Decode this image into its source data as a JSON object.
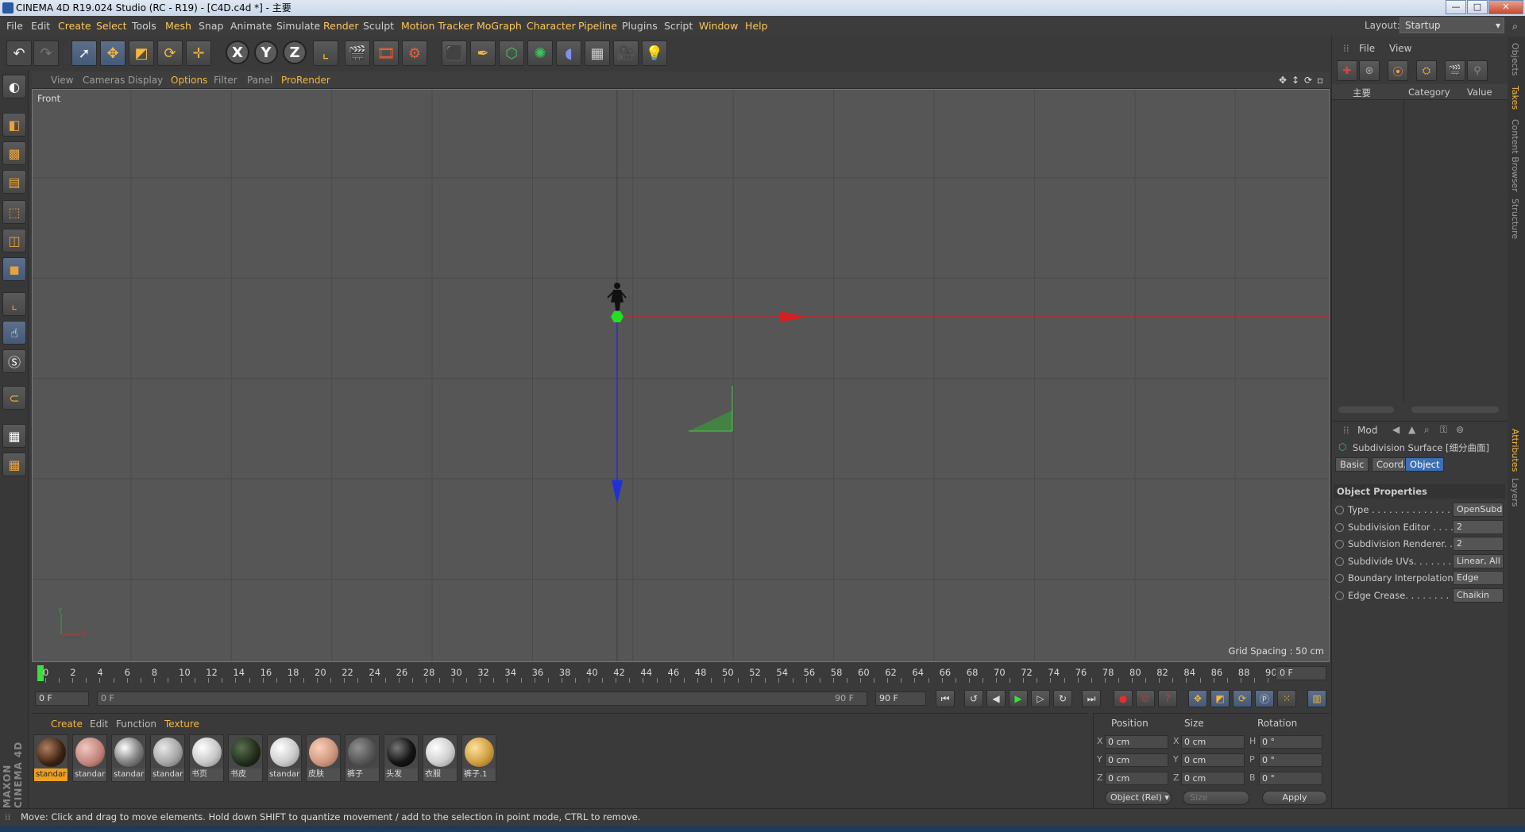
{
  "window": {
    "title": "CINEMA 4D R19.024 Studio (RC - R19) - [C4D.c4d *] - 主要",
    "minimize": "—",
    "maximize": "□",
    "close": "✕"
  },
  "menu": {
    "items": [
      "File",
      "Edit",
      "Create",
      "Select",
      "Tools",
      "Mesh",
      "Snap",
      "Animate",
      "Simulate",
      "Render",
      "Sculpt",
      "Motion Tracker",
      "MoGraph",
      "Character",
      "Pipeline",
      "Plugins",
      "Script",
      "Window",
      "Help"
    ],
    "layout_label": "Layout:",
    "layout_value": "Startup"
  },
  "toolbar": {
    "axis_x": "X",
    "axis_y": "Y",
    "axis_z": "Z"
  },
  "viewport": {
    "menu": [
      "View",
      "Cameras",
      "Display",
      "Options",
      "Filter",
      "Panel",
      "ProRender"
    ],
    "view_name": "Front",
    "grid_spacing": "Grid Spacing : 50 cm",
    "axis_y_label": "Y",
    "axis_x_label": "X",
    "colors": {
      "x_axis": "#d42020",
      "y_axis": "#22b022",
      "z_axis": "#2030d8",
      "origin": "#22e022"
    }
  },
  "timeline": {
    "ticks": [
      "0",
      "2",
      "4",
      "6",
      "8",
      "10",
      "12",
      "14",
      "16",
      "18",
      "20",
      "22",
      "24",
      "26",
      "28",
      "30",
      "32",
      "34",
      "36",
      "38",
      "40",
      "42",
      "44",
      "46",
      "48",
      "50",
      "52",
      "54",
      "56",
      "58",
      "60",
      "62",
      "64",
      "66",
      "68",
      "70",
      "72",
      "74",
      "76",
      "78",
      "80",
      "82",
      "84",
      "86",
      "88",
      "90"
    ],
    "current_frame": "0 F",
    "start_field": "0 F",
    "range_start": "0 F",
    "range_end": "90 F",
    "end_field": "90 F"
  },
  "materials": {
    "tabs": [
      "Create",
      "Edit",
      "Function",
      "Texture"
    ],
    "items": [
      {
        "label": "standar",
        "color": "radial-gradient(circle at 35% 35%, #b08060, #3a2010 60%, #111)"
      },
      {
        "label": "standar",
        "color": "radial-gradient(circle at 35% 35%, #f0c8c0, #c08078 60%, #6a3a34)"
      },
      {
        "label": "standar",
        "color": "radial-gradient(circle at 35% 35%, #ffffff, #888 50%, #333)"
      },
      {
        "label": "standar",
        "color": "radial-gradient(circle at 35% 35%, #e8e8e8, #a8a8a8 55%, #5a5a5a)"
      },
      {
        "label": "书页",
        "color": "radial-gradient(circle at 35% 35%, #ffffff, #c8c8c8 55%, #777)"
      },
      {
        "label": "书皮",
        "color": "radial-gradient(circle at 35% 35%, #5a7050, #202a1a 60%, #0a0a0a)"
      },
      {
        "label": "standar",
        "color": "radial-gradient(circle at 35% 35%, #ffffff, #cccccc 55%, #808080)"
      },
      {
        "label": "皮肤",
        "color": "radial-gradient(circle at 35% 35%, #f8d0b8, #d09880 55%, #8a5a48)"
      },
      {
        "label": "裤子",
        "color": "radial-gradient(circle at 35% 35%, #909090, #555 55%, #2a2a2a)"
      },
      {
        "label": "头发",
        "color": "radial-gradient(circle at 35% 35%, #777, #151515 55%, #000)"
      },
      {
        "label": "衣服",
        "color": "radial-gradient(circle at 35% 35%, #ffffff, #cfcfcf 55%, #808080)"
      },
      {
        "label": "裤子.1",
        "color": "radial-gradient(circle at 35% 35%, #ffe0a0, #d0a040 55%, #7a5a20)"
      }
    ]
  },
  "coords": {
    "headers": [
      "Position",
      "Size",
      "Rotation"
    ],
    "rows": [
      {
        "pos_axis": "X",
        "pos": "0 cm",
        "size_axis": "X",
        "size": "0 cm",
        "rot_axis": "H",
        "rot": "0 °"
      },
      {
        "pos_axis": "Y",
        "pos": "0 cm",
        "size_axis": "Y",
        "size": "0 cm",
        "rot_axis": "P",
        "rot": "0 °"
      },
      {
        "pos_axis": "Z",
        "pos": "0 cm",
        "size_axis": "Z",
        "size": "0 cm",
        "rot_axis": "B",
        "rot": "0 °"
      }
    ],
    "mode": "Object (Rel)",
    "size_mode": "Size",
    "apply": "Apply"
  },
  "objects_panel": {
    "menu": [
      "File",
      "View"
    ],
    "take_name": "主要",
    "col_category": "Category",
    "col_value": "Value"
  },
  "attributes": {
    "mode_label": "Mod",
    "object_title": "Subdivision Surface [细分曲面]",
    "tabs": [
      "Basic",
      "Coord.",
      "Object"
    ],
    "section": "Object Properties",
    "props": [
      {
        "name": "Type . . . . . . . . . . . . . . . .",
        "value": "OpenSubd"
      },
      {
        "name": "Subdivision Editor . . . .",
        "value": "2"
      },
      {
        "name": "Subdivision Renderer. .",
        "value": "2"
      },
      {
        "name": "Subdivide UVs. . . . . . . .",
        "value": "Linear, All"
      },
      {
        "name": "Boundary Interpolation",
        "value": "Edge"
      },
      {
        "name": "Edge Crease. . . . . . . . . .",
        "value": "Chaikin"
      }
    ]
  },
  "right_tabs": [
    "Objects",
    "Takes",
    "Content Browser",
    "Structure",
    "Attributes",
    "Layers"
  ],
  "status": "Move: Click and drag to move elements. Hold down SHIFT to quantize movement / add to the selection in point mode, CTRL to remove.",
  "brand": "MAXON CINEMA 4D"
}
